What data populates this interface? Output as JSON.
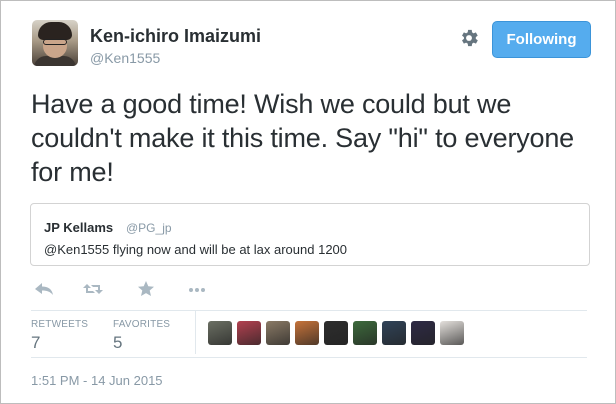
{
  "author": {
    "name": "Ken-ichiro Imaizumi",
    "handle": "@Ken1555"
  },
  "follow_button": {
    "label": "Following"
  },
  "tweet": {
    "text": "Have a good time! Wish we could but we couldn't make it this time. Say \"hi\" to everyone for me!"
  },
  "quoted_tweet": {
    "name": "JP Kellams",
    "handle": "@PG_jp",
    "text": "@Ken1555 flying now and will be at lax around 1200"
  },
  "actions": {
    "icons": [
      "reply-icon",
      "retweet-icon",
      "favorite-icon",
      "more-icon"
    ]
  },
  "stats": {
    "retweets_label": "RETWEETS",
    "retweets_count": "7",
    "favorites_label": "FAVORITES",
    "favorites_count": "5"
  },
  "favoriters": [
    {
      "color": "#6b6f63"
    },
    {
      "color": "#b34150"
    },
    {
      "color": "#8a7a66"
    },
    {
      "color": "#c6733a"
    },
    {
      "color": "#2d2d2d"
    },
    {
      "color": "#3d6a3c"
    },
    {
      "color": "#304358"
    },
    {
      "color": "#2e2a45"
    },
    {
      "color": "#e4e0dc"
    }
  ],
  "timestamp": "1:51 PM - 14 Jun 2015",
  "colors": {
    "accent": "#55acee",
    "text": "#292f33",
    "muted": "#8899a6"
  }
}
